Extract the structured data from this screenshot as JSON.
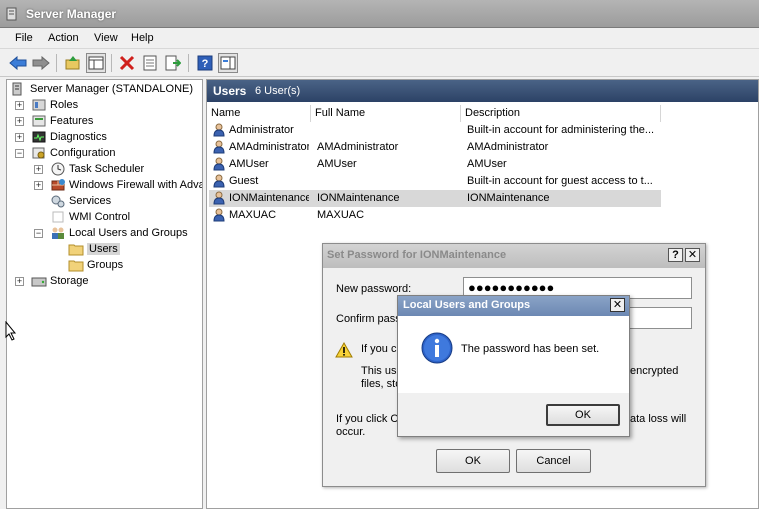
{
  "window": {
    "title": "Server Manager"
  },
  "menu": {
    "file": "File",
    "action": "Action",
    "view": "View",
    "help": "Help"
  },
  "toolbar": {
    "icons": [
      "back-arrow-icon",
      "forward-arrow-icon",
      "up-folder-icon",
      "show-hide-tree-icon",
      "delete-icon",
      "properties-icon",
      "export-list-icon",
      "help-icon",
      "show-action-pane-icon"
    ]
  },
  "tree": {
    "root": "Server Manager (STANDALONE)",
    "roles": "Roles",
    "features": "Features",
    "diagnostics": "Diagnostics",
    "configuration": "Configuration",
    "task_scheduler": "Task Scheduler",
    "firewall": "Windows Firewall with Adva",
    "services": "Services",
    "wmi": "WMI Control",
    "local_users_groups": "Local Users and Groups",
    "users": "Users",
    "groups": "Groups",
    "storage": "Storage"
  },
  "users_panel": {
    "title": "Users",
    "count": "6 User(s)",
    "columns": {
      "name": "Name",
      "full_name": "Full Name",
      "description": "Description"
    },
    "rows": [
      {
        "name": "Administrator",
        "full_name": "",
        "description": "Built-in account for administering the..."
      },
      {
        "name": "AMAdministrator",
        "full_name": "AMAdministrator",
        "description": "AMAdministrator"
      },
      {
        "name": "AMUser",
        "full_name": "AMUser",
        "description": "AMUser"
      },
      {
        "name": "Guest",
        "full_name": "",
        "description": "Built-in account for guest access to t..."
      },
      {
        "name": "IONMaintenance",
        "full_name": "IONMaintenance",
        "description": "IONMaintenance"
      },
      {
        "name": "MAXUAC",
        "full_name": "MAXUAC",
        "description": ""
      }
    ]
  },
  "set_password_dialog": {
    "title": "Set Password for IONMaintenance",
    "help_btn": "?",
    "close_btn": "✕",
    "new_password_label": "New password:",
    "new_password_value": "●●●●●●●●●●●",
    "confirm_label_partial": "Confirm passw",
    "warning_line1_partial": "If you cl",
    "warning_line2_partial": "This use",
    "warning_line2_right": "encrypted",
    "warning_line3_partial": "files, sto",
    "bottom_line1_left": "If you click C",
    "bottom_line1_right": "ata loss will",
    "bottom_line2": "occur.",
    "ok": "OK",
    "cancel": "Cancel"
  },
  "message_dialog": {
    "title": "Local Users and Groups",
    "close_btn": "✕",
    "message": "The password has been set.",
    "ok": "OK"
  }
}
